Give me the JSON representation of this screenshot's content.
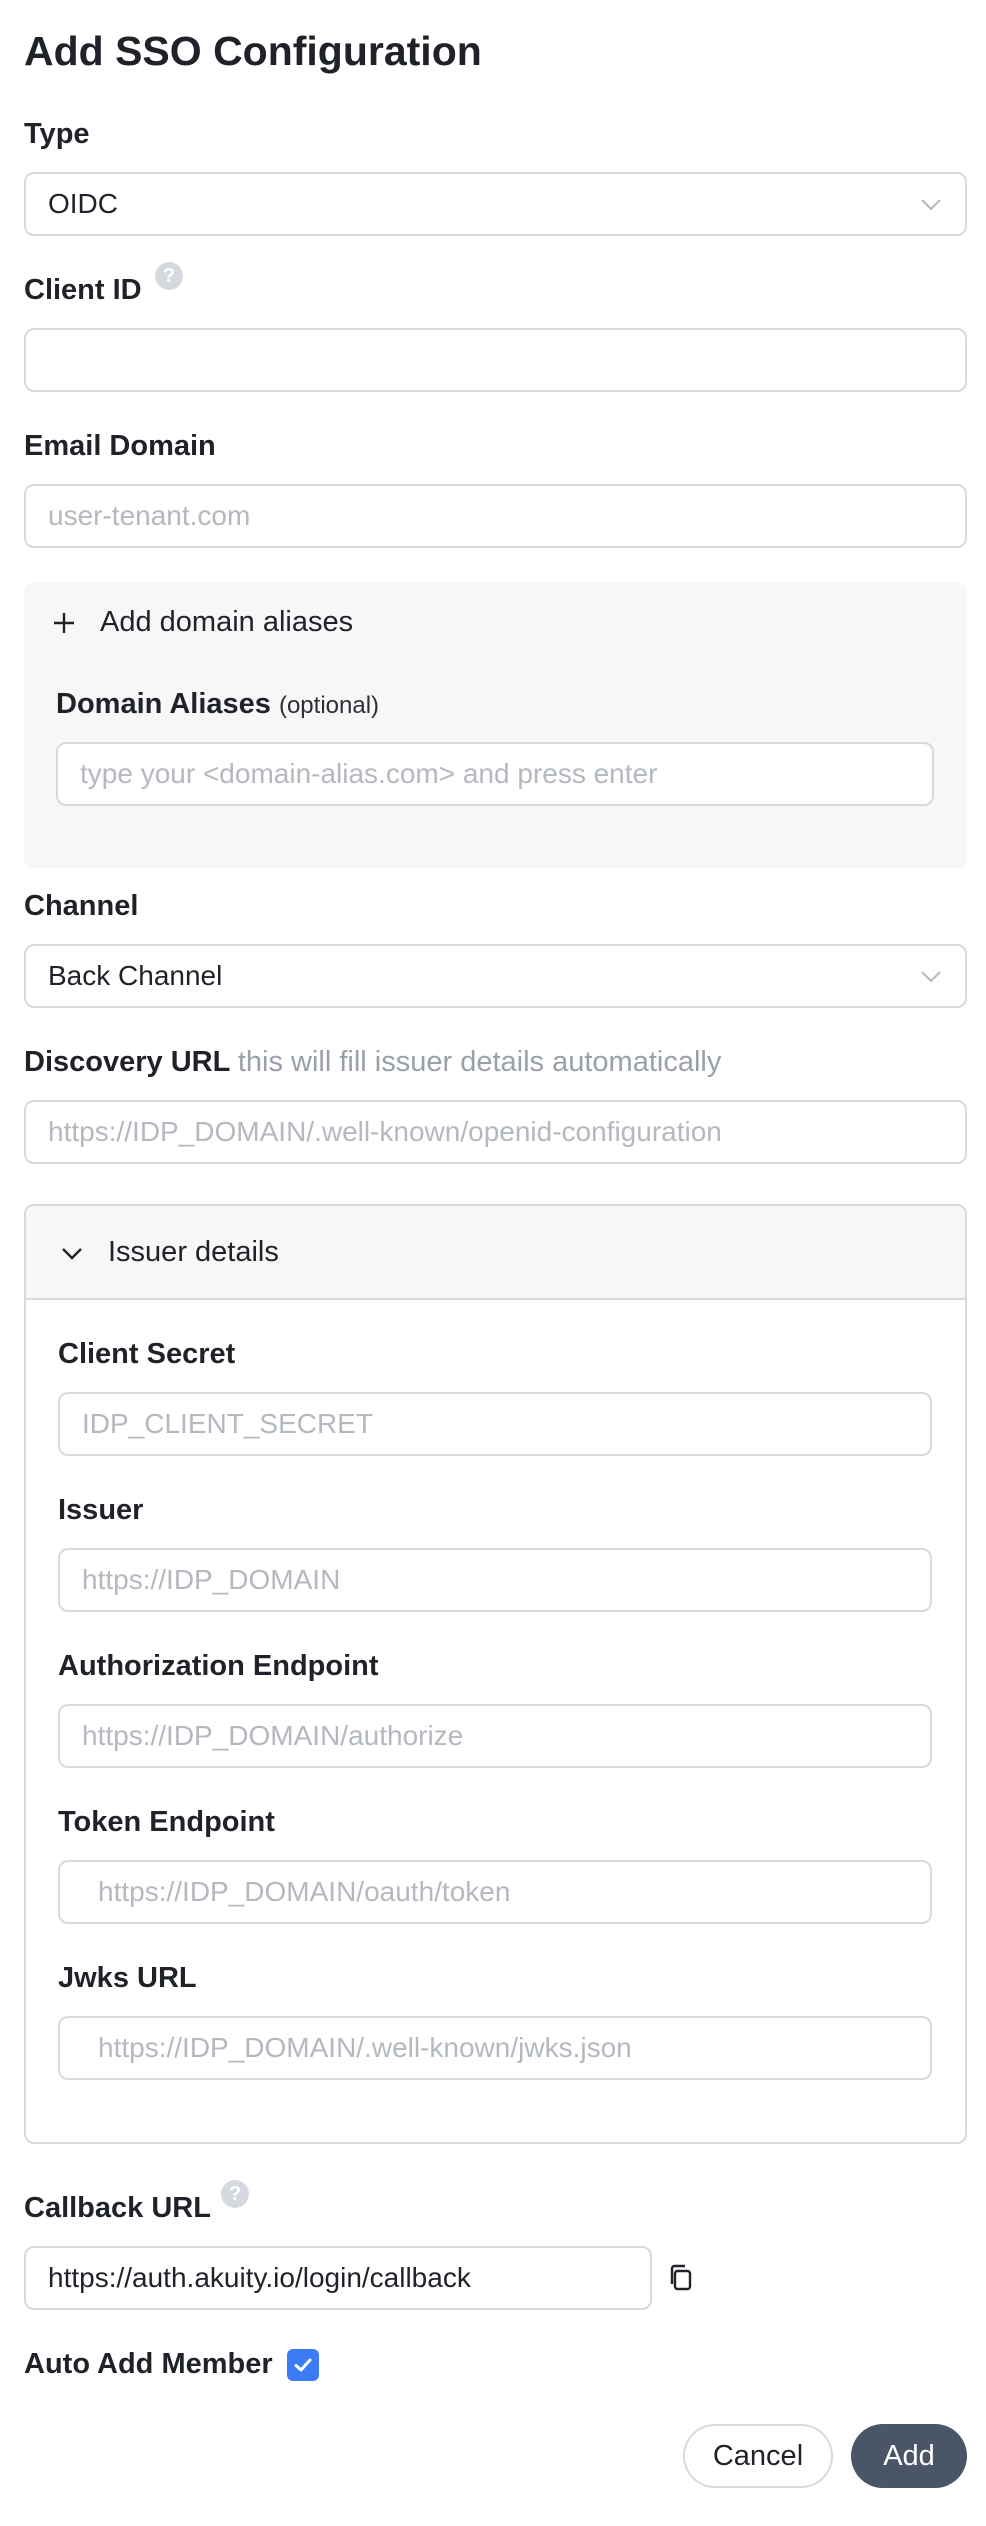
{
  "title": "Add SSO Configuration",
  "type": {
    "label": "Type",
    "value": "OIDC"
  },
  "client_id": {
    "label": "Client ID",
    "help": "?",
    "value": ""
  },
  "email_domain": {
    "label": "Email Domain",
    "placeholder": "user-tenant.com"
  },
  "aliases": {
    "add_label": "Add domain aliases",
    "label": "Domain Aliases",
    "optional": "(optional)",
    "placeholder": "type your <domain-alias.com> and press enter"
  },
  "channel": {
    "label": "Channel",
    "value": "Back Channel"
  },
  "discovery": {
    "label": "Discovery URL",
    "hint": "this will fill issuer details automatically",
    "placeholder": "https://IDP_DOMAIN/.well-known/openid-configuration"
  },
  "issuer_details": {
    "header": "Issuer details",
    "client_secret": {
      "label": "Client Secret",
      "placeholder": "IDP_CLIENT_SECRET"
    },
    "issuer": {
      "label": "Issuer",
      "placeholder": "https://IDP_DOMAIN"
    },
    "authorization": {
      "label": "Authorization Endpoint",
      "placeholder": "https://IDP_DOMAIN/authorize"
    },
    "token": {
      "label": "Token Endpoint",
      "placeholder": "https://IDP_DOMAIN/oauth/token"
    },
    "jwks": {
      "label": "Jwks URL",
      "placeholder": "https://IDP_DOMAIN/.well-known/jwks.json"
    }
  },
  "callback": {
    "label": "Callback URL",
    "help": "?",
    "value": "https://auth.akuity.io/login/callback"
  },
  "auto_add": {
    "label": "Auto Add Member",
    "checked": true
  },
  "buttons": {
    "cancel": "Cancel",
    "add": "Add"
  },
  "colors": {
    "accent": "#3b7bf6",
    "primary_button": "#4a5568",
    "border": "#d9d9d9",
    "placeholder": "#b4b8bf"
  },
  "icons": {
    "select": "chevron-down-icon",
    "help": "question-circle-icon",
    "copy": "copy-icon",
    "add": "plus-icon",
    "collapse": "chevron-down-icon",
    "check": "check-icon"
  }
}
